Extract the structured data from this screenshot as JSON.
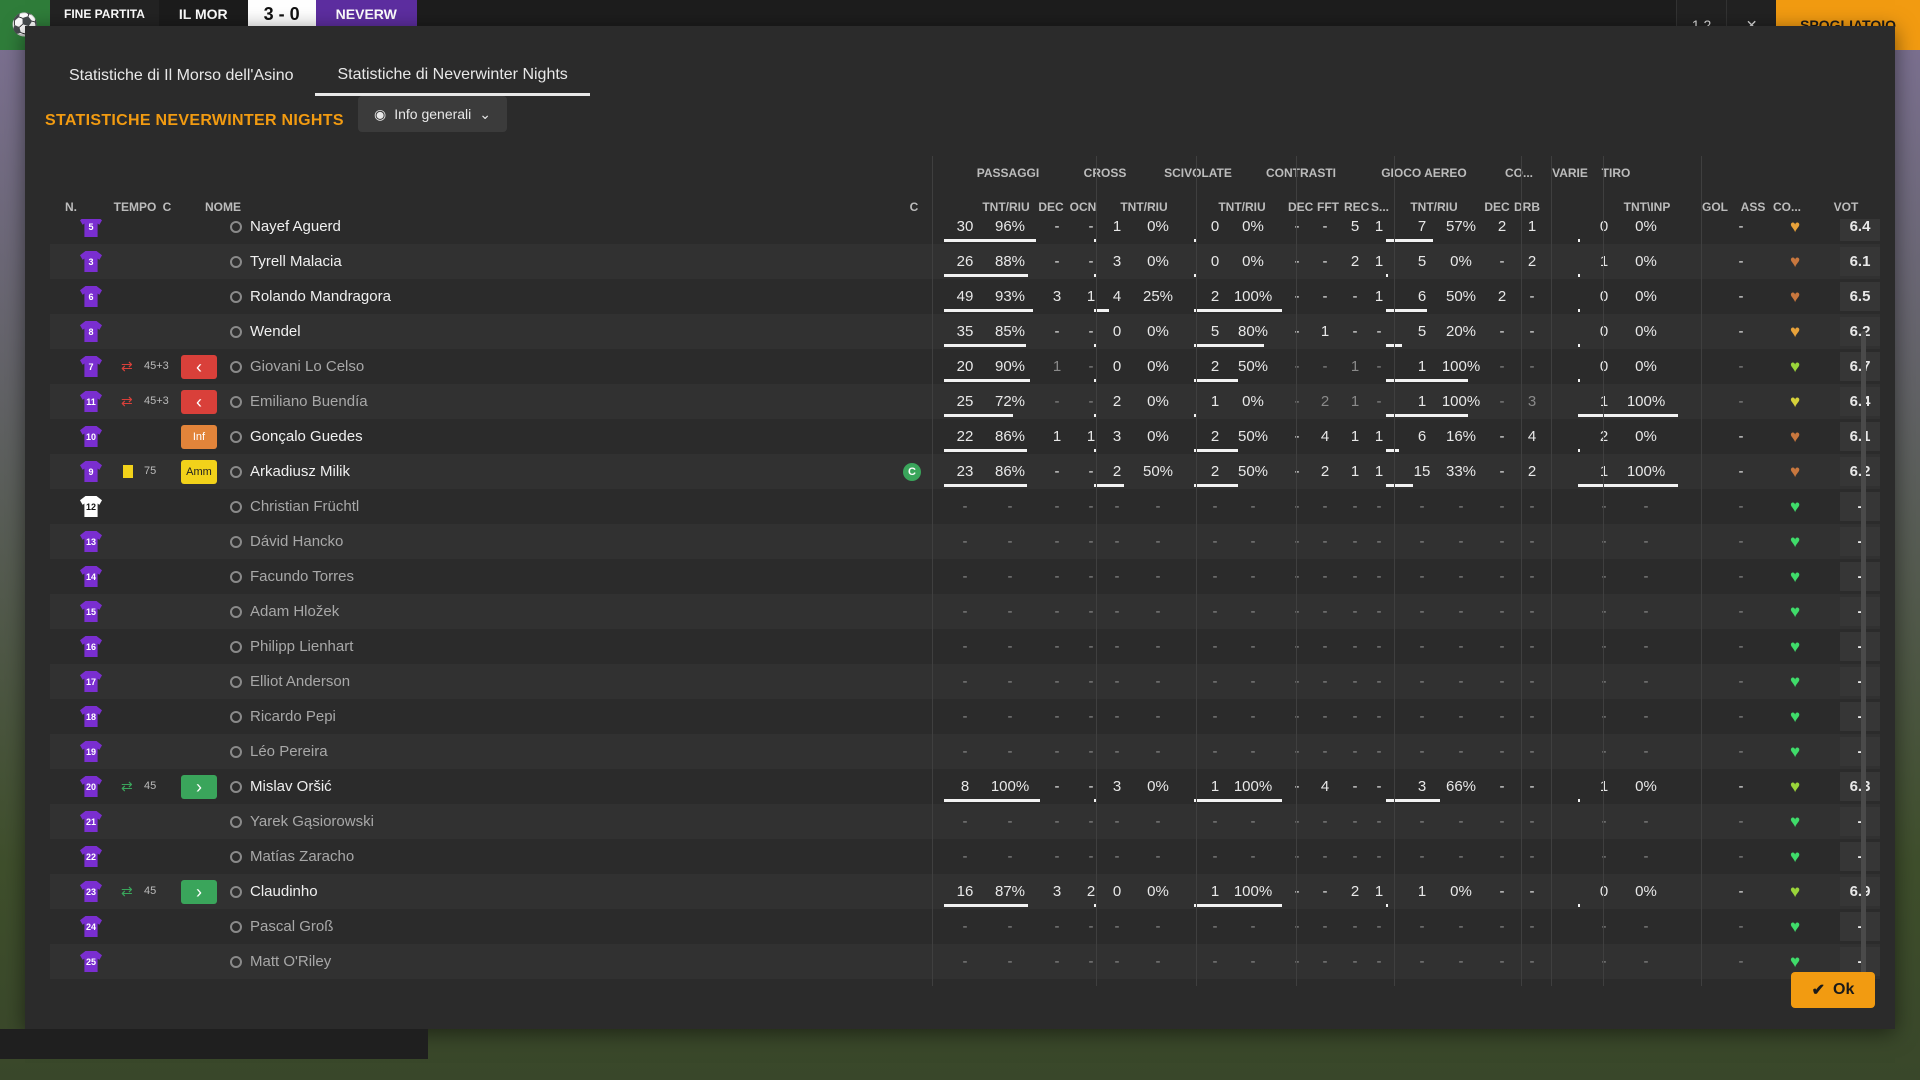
{
  "topbar": {
    "status": "FINE PARTITA",
    "home_team": "IL MOR",
    "score": "3 - 0",
    "away_team": "NEVERW",
    "btn1": "1 2",
    "btn2": "✕",
    "locker": "SPOGLIATOIO"
  },
  "tabs": [
    {
      "label": "Statistiche di Il Morso dell'Asino"
    },
    {
      "label": "Statistiche di Neverwinter Nights"
    }
  ],
  "title": "STATISTICHE NEVERWINTER NIGHTS",
  "view_select": "Info generali",
  "header": {
    "groups": {
      "passaggi": "PASSAGGI",
      "cross": "CROSS",
      "scivolate": "SCIVOLATE",
      "contrasti": "CONTRASTI",
      "gioco_aereo": "GIOCO AEREO",
      "co": "CO...",
      "varie": "VARIE",
      "tiro": "TIRO"
    },
    "cols": {
      "n": "N.",
      "tempo": "TEMPO",
      "c": "C",
      "nome": "NOME",
      "c2": "C",
      "tntriu1": "TNT/RIU",
      "dec": "DEC",
      "ocn": "OCN",
      "tntriu2": "TNT/RIU",
      "tntriu3": "TNT/RIU",
      "dec2": "DEC",
      "fft": "FFT",
      "rec": "REC",
      "s": "S...",
      "tntriu4": "TNT/RIU",
      "dec3": "DEC",
      "drb": "DRB",
      "tntinp": "TNT\\INP",
      "gol": "GOL",
      "ass": "ASS",
      "co2": "CO...",
      "vot": "VOT"
    }
  },
  "players": [
    {
      "num": "5",
      "name": "Nayef Aguerd",
      "pass_t": "30",
      "pass_p": "96%",
      "pass_dec": "-",
      "pass_ocn": "-",
      "cross_t": "1",
      "cross_p": "0%",
      "sciv_t": "0",
      "sciv_p": "0%",
      "con_dec": "-",
      "con_fft": "-",
      "con_rec": "5",
      "con_s": "1",
      "aer_t": "7",
      "aer_p": "57%",
      "co_dec": "2",
      "drb": "1",
      "tiro_t": "0",
      "tiro_p": "0%",
      "gol": "",
      "ass": "-",
      "cond": "orange",
      "vot": "6.4"
    },
    {
      "num": "3",
      "name": "Tyrell Malacia",
      "pass_t": "26",
      "pass_p": "88%",
      "pass_dec": "-",
      "pass_ocn": "-",
      "cross_t": "3",
      "cross_p": "0%",
      "sciv_t": "0",
      "sciv_p": "0%",
      "con_dec": "-",
      "con_fft": "-",
      "con_rec": "2",
      "con_s": "1",
      "aer_t": "5",
      "aer_p": "0%",
      "co_dec": "-",
      "drb": "2",
      "tiro_t": "1",
      "tiro_p": "0%",
      "gol": "",
      "ass": "-",
      "cond": "brown",
      "vot": "6.1"
    },
    {
      "num": "6",
      "name": "Rolando Mandragora",
      "pass_t": "49",
      "pass_p": "93%",
      "pass_dec": "3",
      "pass_ocn": "1",
      "cross_t": "4",
      "cross_p": "25%",
      "sciv_t": "2",
      "sciv_p": "100%",
      "con_dec": "-",
      "con_fft": "-",
      "con_rec": "-",
      "con_s": "1",
      "aer_t": "6",
      "aer_p": "50%",
      "co_dec": "2",
      "drb": "-",
      "tiro_t": "0",
      "tiro_p": "0%",
      "gol": "",
      "ass": "-",
      "cond": "brown",
      "vot": "6.5"
    },
    {
      "num": "8",
      "name": "Wendel",
      "pass_t": "35",
      "pass_p": "85%",
      "pass_dec": "-",
      "pass_ocn": "-",
      "cross_t": "0",
      "cross_p": "0%",
      "sciv_t": "5",
      "sciv_p": "80%",
      "con_dec": "-",
      "con_fft": "1",
      "con_rec": "-",
      "con_s": "-",
      "aer_t": "5",
      "aer_p": "20%",
      "co_dec": "-",
      "drb": "-",
      "tiro_t": "0",
      "tiro_p": "0%",
      "gol": "",
      "ass": "-",
      "cond": "orange",
      "vot": "6.2"
    },
    {
      "num": "7",
      "name": "Giovani Lo Celso",
      "tempo": "45+3",
      "event": "sub-off",
      "pass_t": "20",
      "pass_p": "90%",
      "pass_dec": "1",
      "pass_ocn": "-",
      "cross_t": "0",
      "cross_p": "0%",
      "sciv_t": "2",
      "sciv_p": "50%",
      "con_dec": "-",
      "con_fft": "-",
      "con_rec": "1",
      "con_s": "-",
      "aer_t": "1",
      "aer_p": "100%",
      "co_dec": "-",
      "drb": "-",
      "tiro_t": "0",
      "tiro_p": "0%",
      "gol": "",
      "ass": "-",
      "cond": "lime",
      "vot": "6.7",
      "dim": true
    },
    {
      "num": "11",
      "name": "Emiliano Buendía",
      "tempo": "45+3",
      "event": "sub-off",
      "pass_t": "25",
      "pass_p": "72%",
      "pass_dec": "-",
      "pass_ocn": "-",
      "cross_t": "2",
      "cross_p": "0%",
      "sciv_t": "1",
      "sciv_p": "0%",
      "con_dec": "-",
      "con_fft": "2",
      "con_rec": "1",
      "con_s": "-",
      "aer_t": "1",
      "aer_p": "100%",
      "co_dec": "-",
      "drb": "3",
      "tiro_t": "1",
      "tiro_p": "100%",
      "gol": "",
      "ass": "-",
      "cond": "yellow",
      "vot": "6.4",
      "dim": true
    },
    {
      "num": "10",
      "name": "Gonçalo Guedes",
      "event": "inf",
      "event_label": "Inf",
      "pass_t": "22",
      "pass_p": "86%",
      "pass_dec": "1",
      "pass_ocn": "1",
      "cross_t": "3",
      "cross_p": "0%",
      "sciv_t": "2",
      "sciv_p": "50%",
      "con_dec": "-",
      "con_fft": "4",
      "con_rec": "1",
      "con_s": "1",
      "aer_t": "6",
      "aer_p": "16%",
      "co_dec": "-",
      "drb": "4",
      "tiro_t": "2",
      "tiro_p": "0%",
      "gol": "",
      "ass": "-",
      "cond": "brown",
      "vot": "6.1"
    },
    {
      "num": "9",
      "name": "Arkadiusz Milik",
      "tempo": "75",
      "event": "amm",
      "event_label": "Amm",
      "captain": "C",
      "pass_t": "23",
      "pass_p": "86%",
      "pass_dec": "-",
      "pass_ocn": "-",
      "cross_t": "2",
      "cross_p": "50%",
      "sciv_t": "2",
      "sciv_p": "50%",
      "con_dec": "-",
      "con_fft": "2",
      "con_rec": "1",
      "con_s": "1",
      "aer_t": "15",
      "aer_p": "33%",
      "co_dec": "-",
      "drb": "2",
      "tiro_t": "1",
      "tiro_p": "100%",
      "gol": "",
      "ass": "-",
      "cond": "brown",
      "vot": "6.2"
    },
    {
      "num": "12",
      "name": "Christian Früchtl",
      "gk": true,
      "empty": true,
      "cond": "green",
      "vot": "-"
    },
    {
      "num": "13",
      "name": "Dávid Hancko",
      "empty": true,
      "cond": "green",
      "vot": "-"
    },
    {
      "num": "14",
      "name": "Facundo Torres",
      "empty": true,
      "cond": "green",
      "vot": "-"
    },
    {
      "num": "15",
      "name": "Adam Hložek",
      "empty": true,
      "cond": "green",
      "vot": "-"
    },
    {
      "num": "16",
      "name": "Philipp Lienhart",
      "empty": true,
      "cond": "green",
      "vot": "-"
    },
    {
      "num": "17",
      "name": "Elliot Anderson",
      "empty": true,
      "cond": "green",
      "vot": "-"
    },
    {
      "num": "18",
      "name": "Ricardo Pepi",
      "empty": true,
      "cond": "green",
      "vot": "-"
    },
    {
      "num": "19",
      "name": "Léo Pereira",
      "empty": true,
      "cond": "green",
      "vot": "-"
    },
    {
      "num": "20",
      "name": "Mislav Oršić",
      "tempo": "45",
      "event": "sub-on",
      "pass_t": "8",
      "pass_p": "100%",
      "pass_dec": "-",
      "pass_ocn": "-",
      "cross_t": "3",
      "cross_p": "0%",
      "sciv_t": "1",
      "sciv_p": "100%",
      "con_dec": "-",
      "con_fft": "4",
      "con_rec": "-",
      "con_s": "-",
      "aer_t": "3",
      "aer_p": "66%",
      "co_dec": "-",
      "drb": "-",
      "tiro_t": "1",
      "tiro_p": "0%",
      "gol": "",
      "ass": "-",
      "cond": "lime",
      "vot": "6.3"
    },
    {
      "num": "21",
      "name": "Yarek Gąsiorowski",
      "empty": true,
      "cond": "green",
      "vot": "-"
    },
    {
      "num": "22",
      "name": "Matías Zaracho",
      "empty": true,
      "cond": "green",
      "vot": "-"
    },
    {
      "num": "23",
      "name": "Claudinho",
      "tempo": "45",
      "event": "sub-on",
      "pass_t": "16",
      "pass_p": "87%",
      "pass_dec": "3",
      "pass_ocn": "2",
      "cross_t": "0",
      "cross_p": "0%",
      "sciv_t": "1",
      "sciv_p": "100%",
      "con_dec": "-",
      "con_fft": "-",
      "con_rec": "2",
      "con_s": "1",
      "aer_t": "1",
      "aer_p": "0%",
      "co_dec": "-",
      "drb": "-",
      "tiro_t": "0",
      "tiro_p": "0%",
      "gol": "",
      "ass": "-",
      "cond": "lime",
      "vot": "6.9"
    },
    {
      "num": "24",
      "name": "Pascal Groß",
      "empty": true,
      "cond": "green",
      "vot": "-"
    },
    {
      "num": "25",
      "name": "Matt O'Riley",
      "empty": true,
      "cond": "green",
      "vot": "-"
    }
  ],
  "colors": {
    "accent": "#f29b11",
    "shirt": "#7a2ed0",
    "green": "#3aa55b",
    "red": "#d9403a"
  },
  "ok_label": "Ok"
}
